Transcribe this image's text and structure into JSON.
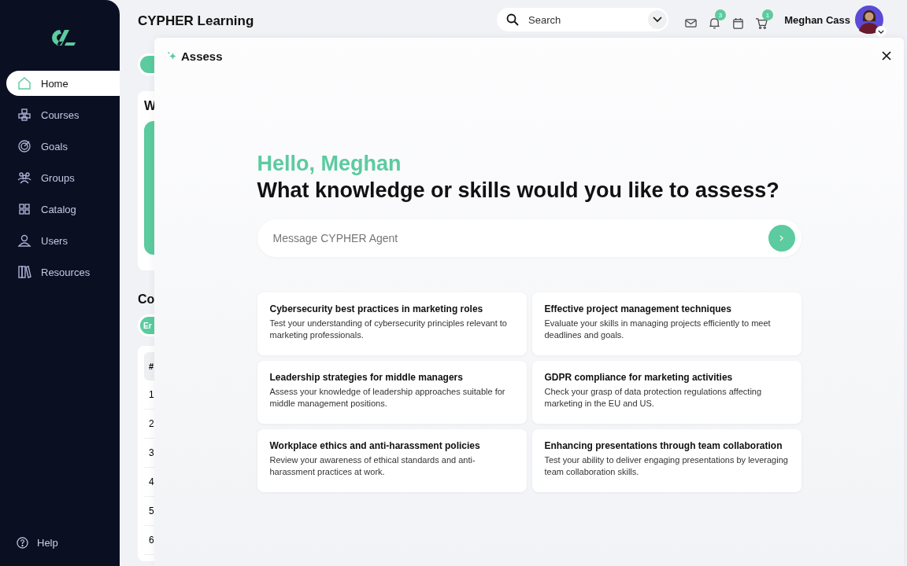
{
  "sidebar": {
    "items": [
      {
        "label": "Home",
        "selected": true
      },
      {
        "label": "Courses",
        "selected": false
      },
      {
        "label": "Goals",
        "selected": false
      },
      {
        "label": "Groups",
        "selected": false
      },
      {
        "label": "Catalog",
        "selected": false
      },
      {
        "label": "Users",
        "selected": false
      },
      {
        "label": "Resources",
        "selected": false
      }
    ],
    "help": "Help"
  },
  "header": {
    "title": "CYPHER Learning",
    "search": {
      "placeholder": "Search"
    },
    "icons": [
      {
        "kind": "mail"
      },
      {
        "kind": "bell",
        "badge": "3"
      },
      {
        "kind": "calendar"
      },
      {
        "kind": "cart",
        "badge": "1"
      }
    ],
    "user": "Meghan Cass"
  },
  "background_page": {
    "card_heading": "W",
    "section_heading": "Co",
    "pill_2": "Er",
    "table_header": "#",
    "row_numbers": [
      "1",
      "2",
      "3",
      "4",
      "5",
      "6"
    ]
  },
  "assess_panel": {
    "title": "Assess",
    "greeting": "Hello, Meghan",
    "question": "What knowledge or skills would you like to assess?",
    "message": {
      "placeholder": "Message CYPHER Agent"
    },
    "suggestions": [
      {
        "title": "Cybersecurity best practices in marketing roles",
        "description": "Test your understanding of cybersecurity principles relevant to marketing professionals."
      },
      {
        "title": "Effective project management techniques",
        "description": "Evaluate your skills in managing projects efficiently to meet deadlines and goals."
      },
      {
        "title": "Leadership strategies for middle managers",
        "description": "Assess your knowledge of leadership approaches suitable for middle management positions."
      },
      {
        "title": "GDPR compliance for marketing activities",
        "description": "Check your grasp of data protection regulations affecting marketing in the EU and US."
      },
      {
        "title": "Workplace ethics and anti-harassment policies",
        "description": "Review your awareness of ethical standards and anti-harassment practices at work."
      },
      {
        "title": "Enhancing presentations through team collaboration",
        "description": "Test your ability to deliver engaging presentations by leveraging team collaboration skills."
      }
    ]
  }
}
